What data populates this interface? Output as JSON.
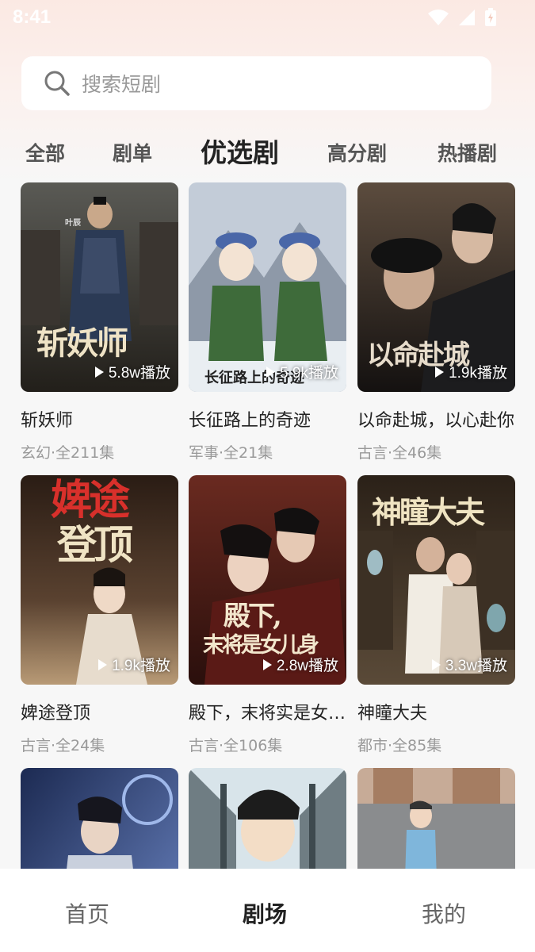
{
  "status_bar": {
    "time": "8:41"
  },
  "search": {
    "placeholder": "搜索短剧"
  },
  "tabs": [
    {
      "label": "全部"
    },
    {
      "label": "剧单"
    },
    {
      "label": "优选剧",
      "active": true
    },
    {
      "label": "高分剧"
    },
    {
      "label": "热播剧"
    }
  ],
  "cards": [
    {
      "title": "斩妖师",
      "meta": "玄幻·全211集",
      "plays": "5.8w播放",
      "poster_text": "斩妖师",
      "poster_extra": "叶辰",
      "colors": [
        "#3b3a36",
        "#1f2a3a"
      ]
    },
    {
      "title": "长征路上的奇迹",
      "meta": "军事·全21集",
      "plays": "5.9k播放",
      "poster_text": "长征路上的奇迹",
      "colors": [
        "#b8c4d6",
        "#e7edf3"
      ]
    },
    {
      "title": "以命赴城，以心赴你",
      "meta": "古言·全46集",
      "plays": "1.9k播放",
      "poster_text": "以命赴城",
      "colors": [
        "#3a2e26",
        "#16120f"
      ]
    },
    {
      "title": "婢途登顶",
      "meta": "古言·全24集",
      "plays": "1.9k播放",
      "poster_text": "婢途登顶",
      "colors": [
        "#2a1c14",
        "#8a6a48"
      ]
    },
    {
      "title": "殿下，末将实是女儿身",
      "meta": "古言·全106集",
      "plays": "2.8w播放",
      "poster_text": "殿下，末将是女儿身",
      "colors": [
        "#4a1e1a",
        "#7a2a22"
      ]
    },
    {
      "title": "神瞳大夫",
      "meta": "都市·全85集",
      "plays": "3.3w播放",
      "poster_text": "神瞳大夫",
      "colors": [
        "#2b2118",
        "#6d5a40"
      ]
    },
    {
      "colors": [
        "#1c2a52",
        "#3f5b9e"
      ]
    },
    {
      "colors": [
        "#7a8a8f",
        "#d8dde0"
      ]
    },
    {
      "colors": [
        "#b89a86",
        "#8a8c8e"
      ]
    }
  ],
  "bottom_nav": [
    {
      "label": "首页"
    },
    {
      "label": "剧场",
      "active": true
    },
    {
      "label": "我的"
    }
  ]
}
